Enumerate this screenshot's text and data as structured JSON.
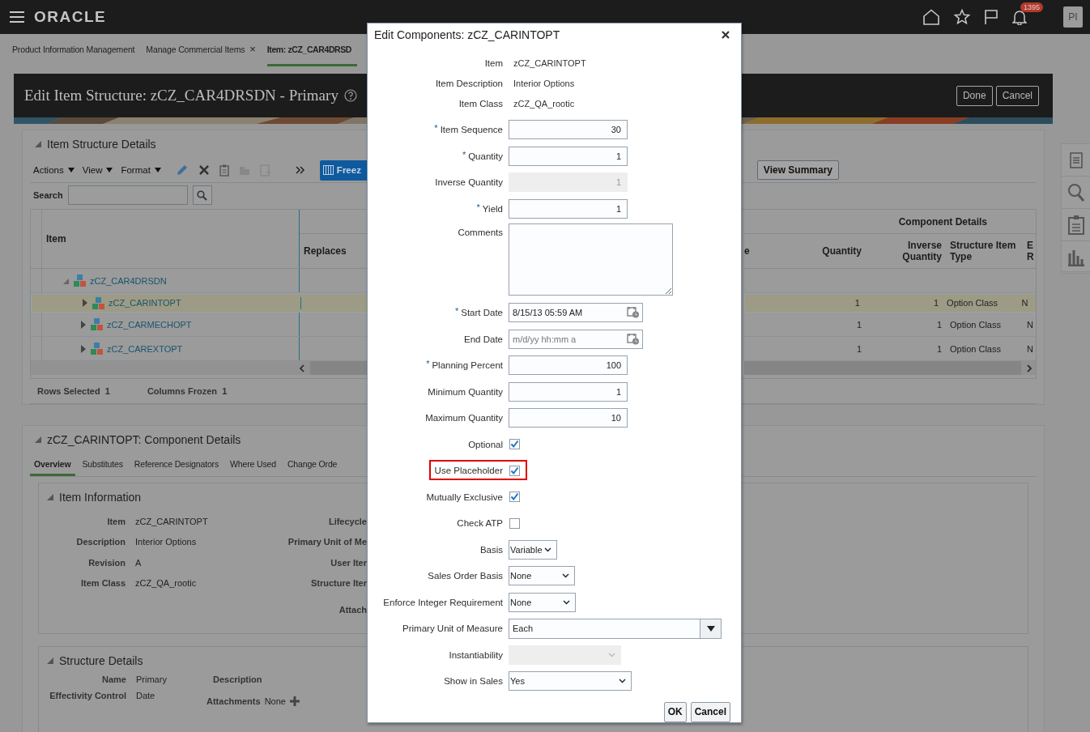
{
  "header": {
    "logo": "ORACLE",
    "notifications": "1395",
    "avatar": "PI"
  },
  "nav_tabs": [
    {
      "label": "Product Information Management",
      "selected": false
    },
    {
      "label": "Manage Commercial Items",
      "selected": false,
      "close": "×"
    },
    {
      "label": "Item: zCZ_CAR4DRSD",
      "selected": true
    }
  ],
  "page": {
    "title": "Edit Item Structure: zCZ_CAR4DRSDN - Primary",
    "buttons": [
      "Done",
      "Cancel"
    ]
  },
  "structure": {
    "title": "Item Structure Details",
    "expanded": true,
    "menus": [
      "Actions",
      "View",
      "Format"
    ],
    "freeze": "Freez",
    "view_summary": "View Summary",
    "search_label": "Search",
    "table": {
      "item_header": "Item",
      "replaces_header": "Replaces",
      "group_header": "Component Details",
      "columns": [
        "e",
        "Quantity",
        "Inverse Quantity",
        "Structure Item Type",
        "E R"
      ],
      "rows": [
        {
          "item": "zCZ_CAR4DRSDN",
          "expanded": true,
          "selected": false,
          "children": [
            {
              "item": "zCZ_CARINTOPT",
              "expanded": false,
              "selected": true,
              "cells": [
                "1",
                "1",
                "Option Class",
                "N"
              ]
            },
            {
              "item": "zCZ_CARMECHOPT",
              "expanded": false,
              "selected": false,
              "cells": [
                "1",
                "1",
                "Option Class",
                "N"
              ]
            },
            {
              "item": "zCZ_CAREXTOPT",
              "expanded": false,
              "selected": false,
              "cells": [
                "1",
                "1",
                "Option Class",
                "N"
              ]
            }
          ]
        }
      ]
    },
    "footer": [
      {
        "label": "Rows Selected",
        "value": "1"
      },
      {
        "label": "Columns Frozen",
        "value": "1"
      }
    ]
  },
  "component": {
    "title": "zCZ_CARINTOPT: Component Details",
    "expanded": true,
    "tabs": [
      {
        "label": "Overview",
        "selected": true
      },
      {
        "label": "Substitutes",
        "selected": false
      },
      {
        "label": "Reference Designators",
        "selected": false
      },
      {
        "label": "Where Used",
        "selected": false
      },
      {
        "label": "Change Orde",
        "selected": false
      }
    ],
    "item_info": {
      "title": "Item Information",
      "expanded": true,
      "fields": [
        {
          "label": "Item",
          "value": "zCZ_CARINTOPT"
        },
        {
          "label": "Description",
          "value": "Interior Options"
        },
        {
          "label": "Revision",
          "value": "A"
        },
        {
          "label": "Item Class",
          "value": "zCZ_QA_rootic"
        }
      ],
      "side_labels": [
        "Lifecycle",
        "Primary Unit of Me",
        "User Iter",
        "Structure Iter",
        "Attach"
      ]
    },
    "structure_details": {
      "title": "Structure Details",
      "expanded": true,
      "name_label": "Name",
      "name": "Primary",
      "description_label": "Description",
      "effectivity_label": "Effectivity Control",
      "effectivity": "Date",
      "attachments_label": "Attachments",
      "attachments": "None"
    }
  },
  "dialog": {
    "title": "Edit Components: zCZ_CARINTOPT",
    "required_mark": "*",
    "fields": [
      {
        "kind": "readonly",
        "label": "Item",
        "value": "zCZ_CARINTOPT"
      },
      {
        "kind": "readonly",
        "label": "Item Description",
        "value": "Interior Options"
      },
      {
        "kind": "readonly",
        "label": "Item Class",
        "value": "zCZ_QA_rootic"
      },
      {
        "kind": "number",
        "label": "Item Sequence",
        "required": true,
        "value": "30"
      },
      {
        "kind": "number",
        "label": "Quantity",
        "required": true,
        "value": "1"
      },
      {
        "kind": "number",
        "label": "Inverse Quantity",
        "disabled": true,
        "value": "1"
      },
      {
        "kind": "number",
        "label": "Yield",
        "required": true,
        "value": "1"
      },
      {
        "kind": "textarea",
        "label": "Comments"
      },
      {
        "kind": "date",
        "label": "Start Date",
        "required": true,
        "value": "8/15/13 05:59 AM"
      },
      {
        "kind": "date",
        "label": "End Date",
        "placeholder": "m/d/yy hh:mm a"
      },
      {
        "kind": "number",
        "label": "Planning Percent",
        "required": true,
        "value": "100"
      },
      {
        "kind": "number",
        "label": "Minimum Quantity",
        "value": "1"
      },
      {
        "kind": "number",
        "label": "Maximum Quantity",
        "value": "10"
      },
      {
        "kind": "checkbox",
        "label": "Optional",
        "checked": true
      },
      {
        "kind": "checkbox",
        "label": "Use Placeholder",
        "checked": true,
        "highlighted": true
      },
      {
        "kind": "checkbox",
        "label": "Mutually Exclusive",
        "checked": true
      },
      {
        "kind": "checkbox",
        "label": "Check ATP",
        "checked": false
      },
      {
        "kind": "select",
        "label": "Basis",
        "value": "Variable"
      },
      {
        "kind": "select",
        "label": "Sales Order Basis",
        "value": "None"
      },
      {
        "kind": "select",
        "label": "Enforce Integer Requirement",
        "value": "None"
      },
      {
        "kind": "combo",
        "label": "Primary Unit of Measure",
        "value": "Each"
      },
      {
        "kind": "select",
        "label": "Instantiability",
        "disabled": true
      },
      {
        "kind": "select",
        "label": "Show in Sales",
        "value": "Yes"
      }
    ],
    "buttons": [
      "OK",
      "Cancel"
    ]
  }
}
